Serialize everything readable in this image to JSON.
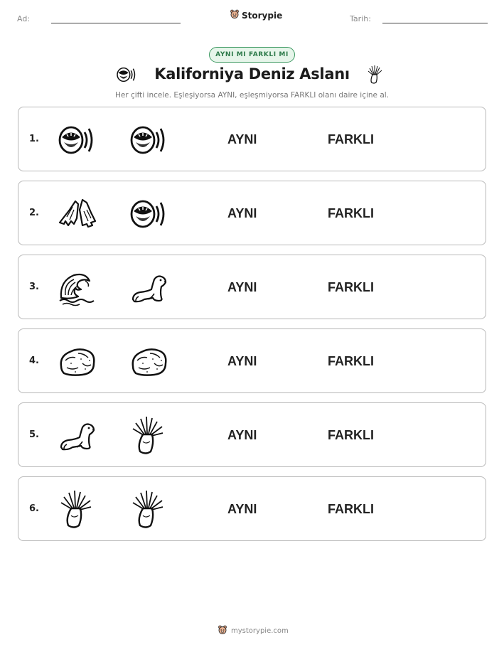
{
  "header": {
    "name_label": "Ad:",
    "date_label": "Tarih:",
    "brand": "Storypie",
    "brand_icon": "bear-logo-icon"
  },
  "badge": "AYNI MI FARKLI MI",
  "title": "Kaliforniya Deniz Aslanı",
  "title_icons": [
    "sound-mouth-icon",
    "sea-anemone-icon"
  ],
  "instructions": "Her çifti incele. Eşleşiyorsa AYNI, eşleşmiyorsa FARKLI olanı daire içine al.",
  "rows": [
    {
      "number": "1.",
      "left": "sound-mouth-icon",
      "right": "sound-mouth-icon",
      "same": "AYNI",
      "different": "FARKLI"
    },
    {
      "number": "2.",
      "left": "flippers-icon",
      "right": "sound-mouth-icon",
      "same": "AYNI",
      "different": "FARKLI"
    },
    {
      "number": "3.",
      "left": "wave-icon",
      "right": "sea-lion-icon",
      "same": "AYNI",
      "different": "FARKLI"
    },
    {
      "number": "4.",
      "left": "rock-icon",
      "right": "rock-icon",
      "same": "AYNI",
      "different": "FARKLI"
    },
    {
      "number": "5.",
      "left": "sea-lion-icon",
      "right": "sea-anemone-icon",
      "same": "AYNI",
      "different": "FARKLI"
    },
    {
      "number": "6.",
      "left": "sea-anemone-icon",
      "right": "sea-anemone-icon",
      "same": "AYNI",
      "different": "FARKLI"
    }
  ],
  "footer": "mystorypie.com"
}
